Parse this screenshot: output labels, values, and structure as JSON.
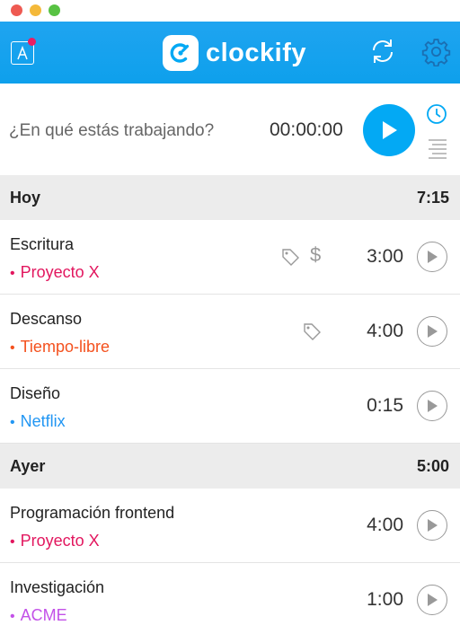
{
  "header": {
    "logo_text": "clockify"
  },
  "timer": {
    "placeholder": "¿En qué estás trabajando?",
    "time": "00:00:00"
  },
  "days": [
    {
      "label": "Hoy",
      "total": "7:15",
      "entries": [
        {
          "description": "Escritura",
          "project": "Proyecto X",
          "project_color": "#e2165e",
          "duration": "3:00",
          "tag": true,
          "billable": true
        },
        {
          "description": "Descanso",
          "project": "Tiempo-libre",
          "project_color": "#f4511e",
          "duration": "4:00",
          "tag": true,
          "billable": false
        },
        {
          "description": "Diseño",
          "project": "Netflix",
          "project_color": "#2196f3",
          "duration": "0:15",
          "tag": false,
          "billable": false
        }
      ]
    },
    {
      "label": "Ayer",
      "total": "5:00",
      "entries": [
        {
          "description": "Programación frontend",
          "project": "Proyecto X",
          "project_color": "#e2165e",
          "duration": "4:00",
          "tag": false,
          "billable": false
        },
        {
          "description": "Investigación",
          "project": "ACME",
          "project_color": "#c351e8",
          "duration": "1:00",
          "tag": false,
          "billable": false
        }
      ]
    }
  ],
  "colors": {
    "brand": "#03a9f4",
    "header": "#1fa4f0",
    "icon_gray": "#999999"
  },
  "icons": {
    "window": [
      "close-icon",
      "minimize-icon",
      "zoom-icon"
    ],
    "header": [
      "language-icon",
      "sync-icon",
      "gear-icon"
    ],
    "timer": [
      "play-icon",
      "clock-mode-icon",
      "list-mode-icon"
    ],
    "entry": [
      "tag-icon",
      "dollar-icon",
      "play-icon"
    ]
  }
}
